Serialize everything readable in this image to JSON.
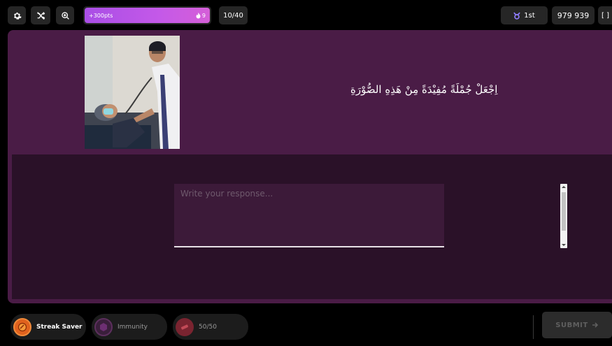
{
  "topbar": {
    "settings_icon": "gear-icon",
    "shuffle_icon": "shuffle-off-icon",
    "zoom_icon": "zoom-in-icon",
    "streak": {
      "points_label": "+300pts",
      "count": "9",
      "fill_fraction": 1.0
    },
    "question_counter": "10/40",
    "rank": {
      "icon": "taurus-icon",
      "label": "1st"
    },
    "score": "979 939",
    "fullscreen_label": "[ ]"
  },
  "question": {
    "text": "اِجْعَلْ جُمْلَةً مُفِيْدَةً مِنْ هَذِهِ الصُّوْرَةِ",
    "image_alt": "doctor with stethoscope examining a masked patient"
  },
  "response": {
    "placeholder": "Write your response..."
  },
  "powerups": [
    {
      "label": "Streak Saver",
      "icon": "streak-saver-icon"
    },
    {
      "label": "Immunity",
      "icon": "immunity-icon"
    },
    {
      "label": "50/50",
      "icon": "fifty-fifty-icon"
    }
  ],
  "submit_label": "SUBMIT",
  "colors": {
    "panel": "#4a1c46",
    "answer_area": "#2a1128",
    "streak_gradient_start": "#a94ee6",
    "streak_gradient_end": "#d55fd8",
    "rank_icon": "#8f7dff"
  }
}
